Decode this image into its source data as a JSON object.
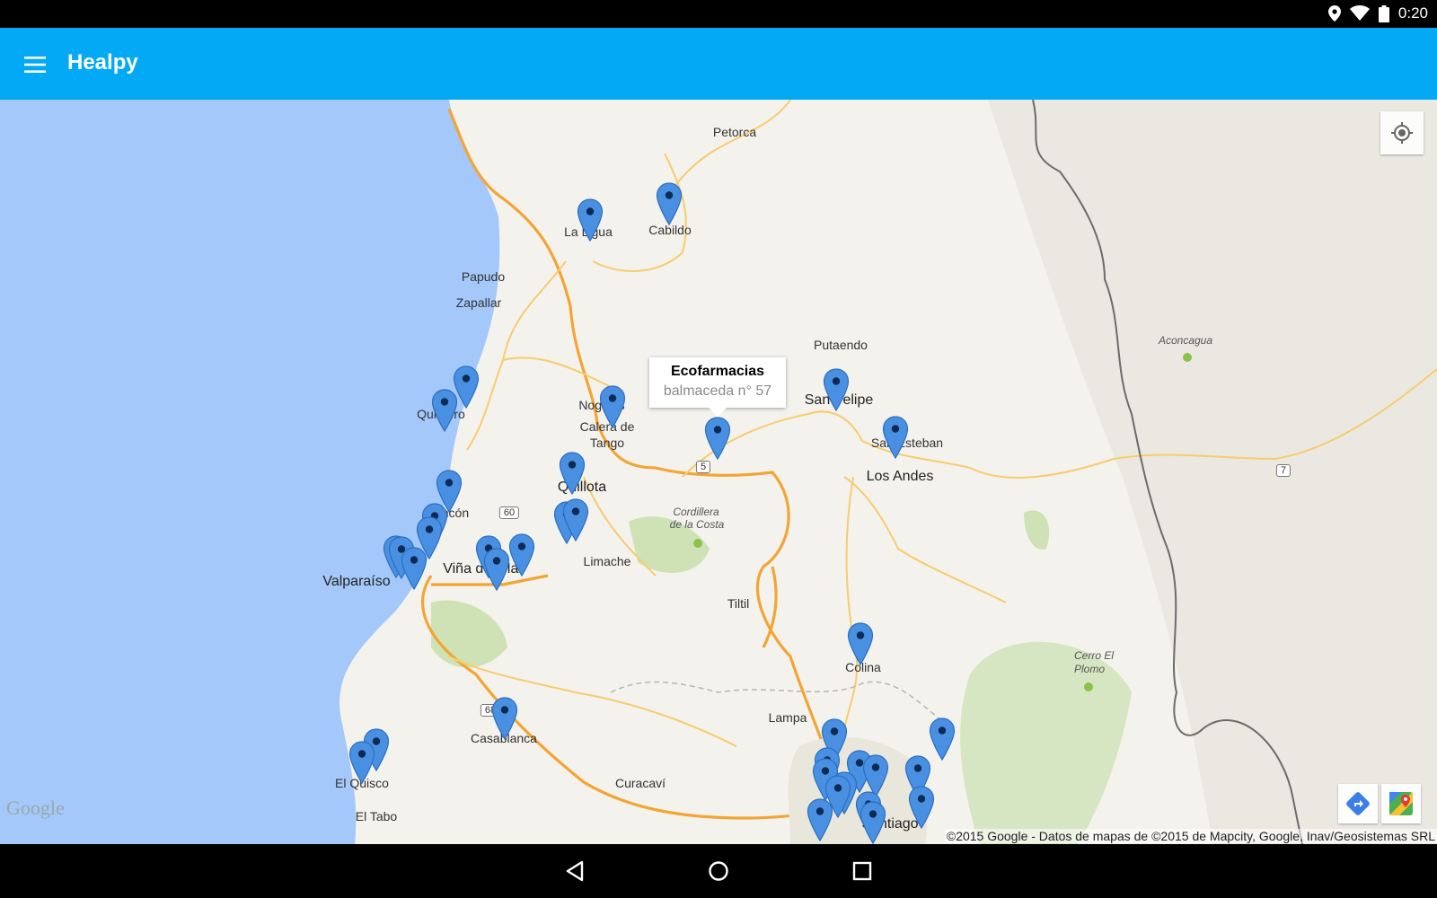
{
  "status_bar": {
    "time": "0:20"
  },
  "app_bar": {
    "title": "Healpy"
  },
  "map": {
    "places": [
      {
        "name": "Petorca",
        "cls": "place"
      },
      {
        "name": "La Ligua",
        "cls": "place"
      },
      {
        "name": "Cabildo",
        "cls": "place"
      },
      {
        "name": "Papudo",
        "cls": "place"
      },
      {
        "name": "Zapallar",
        "cls": "place"
      },
      {
        "name": "Putaendo",
        "cls": "place"
      },
      {
        "name": "Aconcagua",
        "cls": "place terrain"
      },
      {
        "name": "Quintero",
        "cls": "place"
      },
      {
        "name": "Nogales",
        "cls": "place"
      },
      {
        "name": "Calera de",
        "cls": "place"
      },
      {
        "name": "Tango",
        "cls": "place"
      },
      {
        "name": "San Felipe",
        "cls": "place hub"
      },
      {
        "name": "San Esteban",
        "cls": "place"
      },
      {
        "name": "Los Andes",
        "cls": "place hub"
      },
      {
        "name": "Quillota",
        "cls": "place hub"
      },
      {
        "name": "Concón",
        "cls": "place"
      },
      {
        "name": "Cordillera",
        "cls": "place terrain"
      },
      {
        "name": "de la Costa",
        "cls": "place terrain"
      },
      {
        "name": "Viña del Mar",
        "cls": "place big"
      },
      {
        "name": "Valparaíso",
        "cls": "place big"
      },
      {
        "name": "Limache",
        "cls": "place"
      },
      {
        "name": "Tiltil",
        "cls": "place"
      },
      {
        "name": "Colina",
        "cls": "place"
      },
      {
        "name": "Cerro El",
        "cls": "place terrain"
      },
      {
        "name": "Plomo",
        "cls": "place terrain"
      },
      {
        "name": "Lampa",
        "cls": "place"
      },
      {
        "name": "Casablanca",
        "cls": "place"
      },
      {
        "name": "Curacaví",
        "cls": "place"
      },
      {
        "name": "El Quisco",
        "cls": "place"
      },
      {
        "name": "El Tabo",
        "cls": "place"
      },
      {
        "name": "Santiago",
        "cls": "place big"
      }
    ],
    "route_shields": [
      "5",
      "60",
      "7",
      "68"
    ],
    "info_window": {
      "title": "Ecofarmacias",
      "subtitle": "balmaceda n° 57"
    },
    "google_logo": "Google",
    "attribution": "©2015 Google - Datos de mapas de ©2015 de Mapcity, Google, Inav/Geosistemas SRL",
    "marker_color": "#4a90e2",
    "ocean_color": "#a4c8fa",
    "land_color": "#f4f2ec"
  },
  "colors": {
    "app_bar": "#03a9f4",
    "status_bar": "#000000",
    "nav_bar": "#000000"
  },
  "icons": {
    "menu": "hamburger-menu-icon",
    "my_location": "crosshair-icon",
    "directions": "directions-arrow-icon",
    "maps": "google-maps-icon",
    "back": "triangle-back-icon",
    "home": "circle-home-icon",
    "recents": "square-recents-icon"
  }
}
